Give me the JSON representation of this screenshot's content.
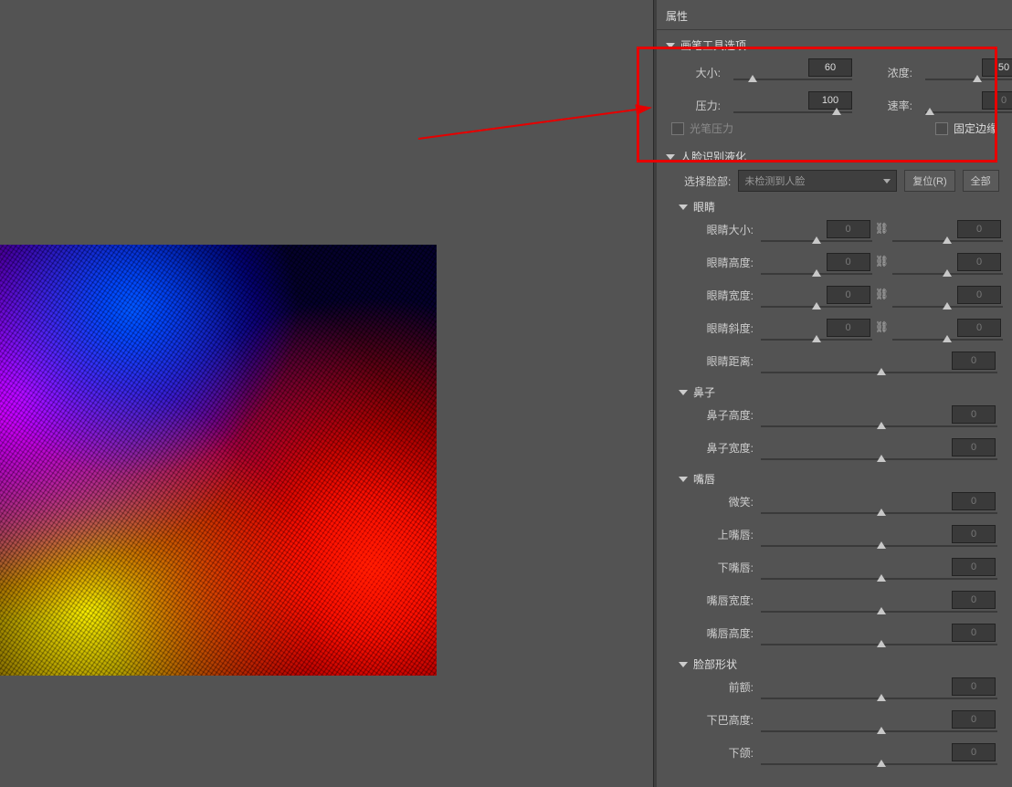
{
  "panel_title": "属性",
  "brush": {
    "header": "画笔工具选项",
    "size_label": "大小:",
    "size_value": "60",
    "density_label": "浓度:",
    "density_value": "50",
    "pressure_label": "压力:",
    "pressure_value": "100",
    "rate_label": "速率:",
    "rate_value": "0",
    "pen_pressure_label": "光笔压力",
    "fixed_edge_label": "固定边缘"
  },
  "face": {
    "header": "人脸识别液化",
    "select_label": "选择脸部:",
    "select_value": "未检测到人脸",
    "reset_btn": "复位(R)",
    "all_btn": "全部",
    "eyes": {
      "header": "眼睛",
      "size": "眼睛大小:",
      "height": "眼睛高度:",
      "width": "眼睛宽度:",
      "tilt": "眼睛斜度:",
      "dist": "眼睛距离:"
    },
    "nose": {
      "header": "鼻子",
      "height": "鼻子高度:",
      "width": "鼻子宽度:"
    },
    "mouth": {
      "header": "嘴唇",
      "smile": "微笑:",
      "upper": "上嘴唇:",
      "lower": "下嘴唇:",
      "width": "嘴唇宽度:",
      "height": "嘴唇高度:"
    },
    "shape": {
      "header": "脸部形状",
      "forehead": "前额:",
      "chin": "下巴高度:",
      "jaw": "下颌:"
    }
  },
  "zero": "0"
}
